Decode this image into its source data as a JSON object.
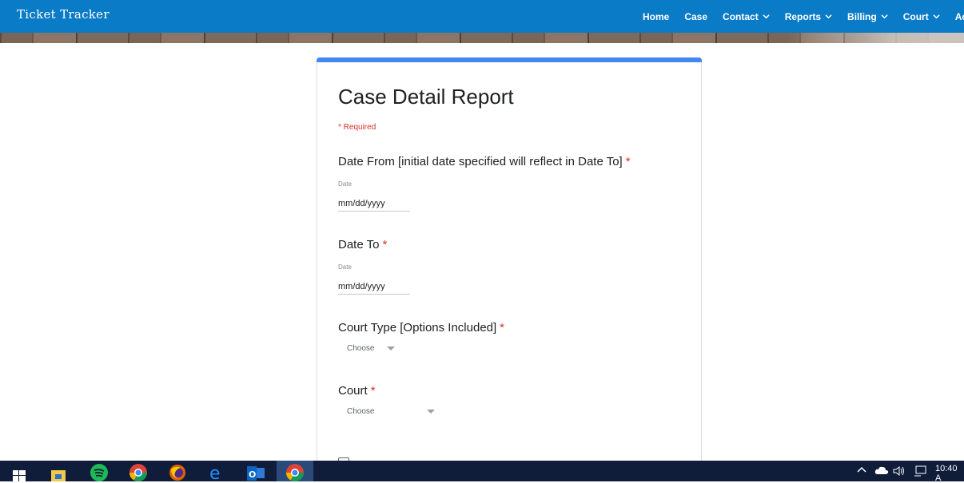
{
  "app": {
    "brand": "Ticket Tracker"
  },
  "nav": [
    {
      "label": "Home",
      "dropdown": false
    },
    {
      "label": "Case",
      "dropdown": false
    },
    {
      "label": "Contact",
      "dropdown": true
    },
    {
      "label": "Reports",
      "dropdown": true
    },
    {
      "label": "Billing",
      "dropdown": true
    },
    {
      "label": "Court",
      "dropdown": true
    },
    {
      "label": "Ac",
      "dropdown": false
    }
  ],
  "form": {
    "title": "Case Detail Report",
    "required_note": "* Required",
    "questions": {
      "date_from": {
        "label": "Date From [initial date specified will reflect in Date To]",
        "sub": "Date",
        "value": "mm/dd/yyyy"
      },
      "date_to": {
        "label": "Date To",
        "sub": "Date",
        "value": "mm/dd/yyyy"
      },
      "court_type": {
        "label": "Court Type [Options Included]",
        "value": "Choose"
      },
      "court": {
        "label": "Court",
        "value": "Choose"
      }
    },
    "required_star": "*"
  },
  "taskbar": {
    "icons": [
      "windows-start-icon",
      "file-explorer-icon",
      "spotify-icon",
      "chrome-icon",
      "firefox-icon",
      "edge-icon",
      "outlook-icon",
      "chrome-active-icon"
    ],
    "clock": "10:40 A"
  },
  "colors": {
    "topbar": "#0a7bc6",
    "accent": "#4285f4",
    "required": "#d93025",
    "taskbar": "#0f1d3a"
  }
}
